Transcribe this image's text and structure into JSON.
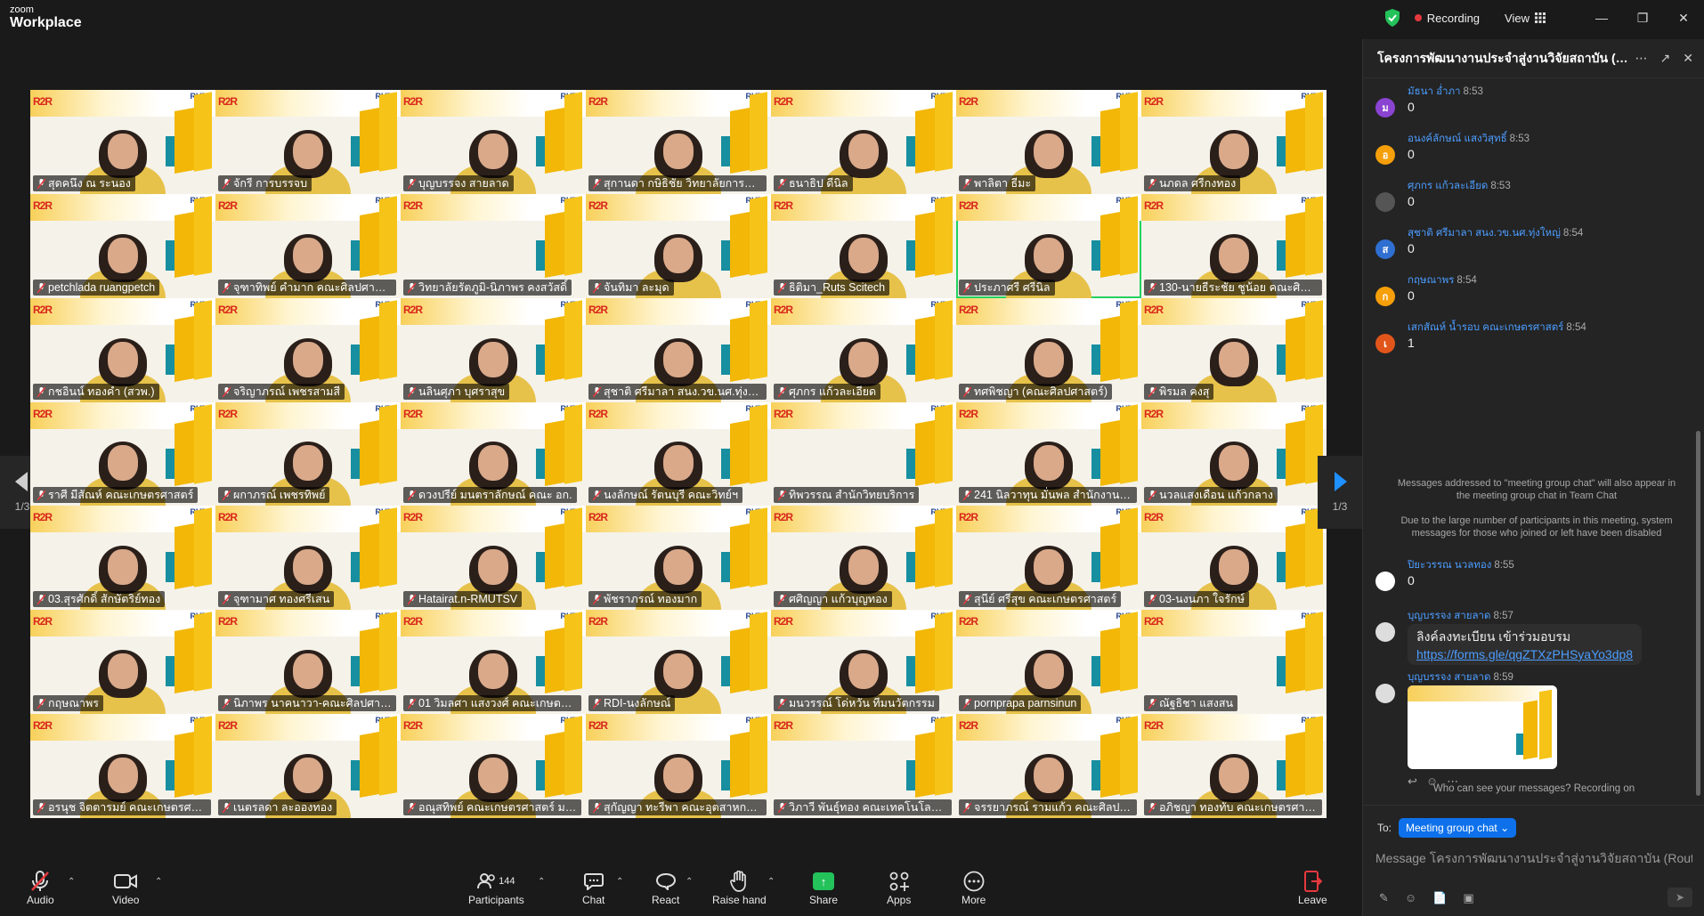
{
  "app": {
    "logo_small": "zoom",
    "logo_big": "Workplace"
  },
  "titlebar": {
    "recording": "Recording",
    "view": "View"
  },
  "navigation": {
    "page_left": "1/3",
    "page_right": "1/3"
  },
  "tiles": [
    "สุดคนึง ณ ระนอง",
    "จักรี การบรรจบ",
    "บุญบรรจง สายลาด",
    "สุกานดา กษิธิชัย วิทยาลัยการช่างนม...",
    "ธนาธิป ดีนิล",
    "พาลิตา ธีมะ",
    "นภดล ศรีกงทอง",
    "petchlada ruangpetch",
    "จุฑาทิพย์ คำมาก คณะศิลปศาสตร์",
    "วิทยาลัยรัตภูมิ-นิภาพร คงสวัสดิ์",
    "จันทิมา ละมุด",
    "ธิติมา_Ruts Scitech",
    "ประภาศรี ศรีนิล",
    "130-นายธีระชัย ชูน้อย คณะศิลปศา...",
    "กชอินน์ ทองคำ (สวพ.)",
    "จริญาภรณ์ เพชรสามสี",
    "นลินศุภา บุศราสุข",
    "สุชาติ ศรีมาลา สนง.วข.นศ.ทุ่งใหญ่",
    "ศุภกร แก้วละเอียด",
    "ทศพิชญา (คณะศิลปศาสตร์)",
    "พิรมล คงสุ",
    "ราศี มีสัณห์ คณะเกษตรศาสตร์",
    "ผกาภรณ์ เพชรทิพย์",
    "ดวงปรีย์ มนตราลักษณ์ คณะ อก.",
    "นงลักษณ์ รัตนบุรี คณะวิทย์ฯ",
    "ทิพวรรณ สำนักวิทยบริการ",
    "241 นิลวาทุน มั่นพล สำนักงานวิจ...",
    "นวลแสงเดือน แก้วกลาง",
    "03.สุรศักดิ์ สักษัตริย์ทอง",
    "จุฑามาศ ทองศรีเสน",
    "Hatairat.n-RMUTSV",
    "พัชราภรณ์ ทองมาก",
    "ศศิญญา แก้วบุญทอง",
    "สุนีย์ ศรีสุข คณะเกษตรศาสตร์",
    "03-นงนภา ใจรักษ์",
    "กฤษณาพร",
    "นิภาพร นาคนาวา-คณะศิลปศาสตร์",
    "01 วิมลศา แสงวงศ์ คณะเกษตรศาสตร์",
    "RDI-นงลักษณ์",
    "มนวรรณ์ โด่หวัน ทีมนวัตกรรม",
    "pornprapa parnsinun",
    "ณัฐธิชา แสงสน",
    "อรนุช จิตตารมย์ คณะเกษตรศาสตร์",
    "เนตรลดา ละอองทอง",
    "อณุสทิพย์ คณะเกษตรศาสตร์ มท...",
    "สุกัญญา ทะรีพา คณะอุตสาหกรรมเก...",
    "วิภาวี พันธุ์ทอง คณะเทคโนโลยีการ...",
    "จรรยาภรณ์ รามแก้ว คณะศิลปศาสตร์",
    "อภิชญา ทองทับ คณะเกษตรศาสตร์"
  ],
  "toolbar": {
    "audio": "Audio",
    "video": "Video",
    "participants": "Participants",
    "participants_count": "144",
    "chat": "Chat",
    "react": "React",
    "raise_hand": "Raise hand",
    "share": "Share",
    "apps": "Apps",
    "more": "More",
    "leave": "Leave"
  },
  "chat": {
    "title": "โครงการพัฒนางานประจำสู่งานวิจัยสถาบัน (Ro...",
    "messages": [
      {
        "sender": "มัธนา อ่ำภา",
        "time": "8:53",
        "text": "0",
        "initial": "ม",
        "color": "#8b43d1"
      },
      {
        "sender": "อนงค์ลักษณ์ แสงวิสุทธิ์",
        "time": "8:53",
        "text": "0",
        "initial": "อ",
        "color": "#f59f0a"
      },
      {
        "sender": "ศุภกร แก้วละเอียด",
        "time": "8:53",
        "text": "0",
        "initial": "",
        "color": "#555555"
      },
      {
        "sender": "สุชาติ ศรีมาลา สนง.วข.นศ.ทุ่งใหญ่",
        "time": "8:54",
        "text": "0",
        "initial": "ส",
        "color": "#2f6fd1"
      },
      {
        "sender": "กฤษณาพร",
        "time": "8:54",
        "text": "0",
        "initial": "ก",
        "color": "#f59f0a"
      },
      {
        "sender": "เสกสัณห์ น้ำรอบ คณะเกษตรศาสตร์",
        "time": "8:54",
        "text": "1",
        "initial": "เ",
        "color": "#e2551a"
      }
    ],
    "system_note_1": "Messages addressed to \"meeting group chat\" will also appear in the meeting group chat in Team Chat",
    "system_note_2": "Due to the large number of participants in this meeting, system messages for those who joined or left have been disabled",
    "msg_piya": {
      "sender": "ปิยะวรรณ นวลทอง",
      "time": "8:55",
      "text": "0"
    },
    "msg_link": {
      "sender": "บุญบรรจง สายลาด",
      "time": "8:57",
      "text": "ลิงค์ลงทะเบียน เข้าร่วมอบรม",
      "link": "https://forms.gle/qgZTXzPHSyaYo3dp8"
    },
    "msg_img": {
      "sender": "บุญบรรจง สายลาด",
      "time": "8:59"
    },
    "who_can_see": "Who can see your messages? Recording on",
    "to_label": "To:",
    "to_target": "Meeting group chat",
    "input_placeholder": "Message โครงการพัฒนางานประจำสู่งานวิจัยสถาบัน (Rout..."
  },
  "colors": {
    "accent": "#0e71eb",
    "share_green": "#23c25b",
    "recording_red": "#e5393e",
    "active_speaker": "#23d160"
  }
}
